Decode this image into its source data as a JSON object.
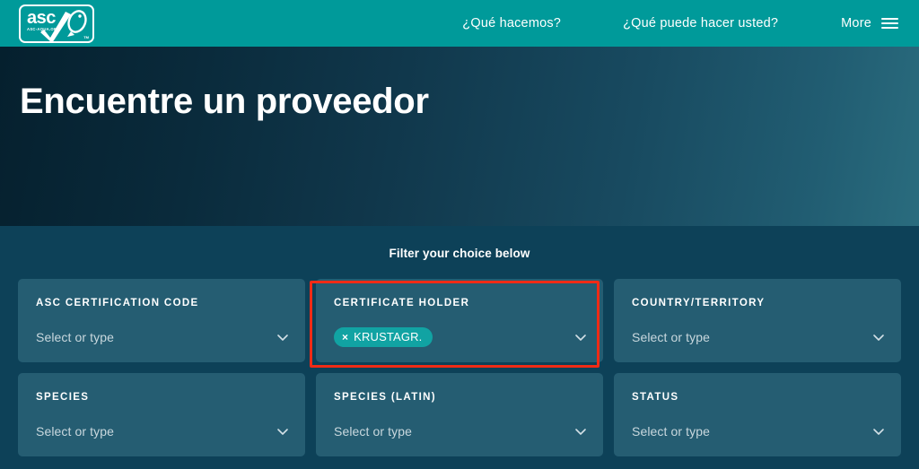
{
  "nav": {
    "logo": {
      "name": "asc-logo",
      "word": "asc",
      "subtitle": "ASC-AQUA.ORG",
      "tm": "TM"
    },
    "items": [
      {
        "label": "¿Qué hacemos?",
        "name": "nav-que-hacemos"
      },
      {
        "label": "¿Qué puede hacer usted?",
        "name": "nav-que-puede-hacer-usted"
      }
    ],
    "more_label": "More",
    "menu_icon": "hamburger-menu-icon"
  },
  "hero": {
    "title": "Encuentre un proveedor"
  },
  "filters": {
    "heading": "Filter your choice below",
    "default_placeholder": "Select or type",
    "cards": [
      {
        "label": "ASC CERTIFICATION CODE",
        "name": "filter-asc-certification-code",
        "placeholder": "Select or type",
        "value": null,
        "highlighted": false
      },
      {
        "label": "CERTIFICATE HOLDER",
        "name": "filter-certificate-holder",
        "placeholder": "Select or type",
        "value": "KRUSTAGR...",
        "highlighted": true
      },
      {
        "label": "COUNTRY/TERRITORY",
        "name": "filter-country-territory",
        "placeholder": "Select or type",
        "value": null,
        "highlighted": false
      },
      {
        "label": "SPECIES",
        "name": "filter-species",
        "placeholder": "Select or type",
        "value": null,
        "highlighted": false
      },
      {
        "label": "SPECIES (LATIN)",
        "name": "filter-species-latin",
        "placeholder": "Select or type",
        "value": null,
        "highlighted": false
      },
      {
        "label": "STATUS",
        "name": "filter-status",
        "placeholder": "Select or type",
        "value": null,
        "highlighted": false
      }
    ],
    "chip_remove_glyph": "×"
  },
  "colors": {
    "brand_teal": "#009a9a",
    "chip_teal": "#11a3a3",
    "section_bg": "#0d4158",
    "card_bg": "#255d72",
    "highlight_red": "#f02b16",
    "hero_gradient_start": "#05202e",
    "hero_gradient_end": "#2a6c7e"
  }
}
